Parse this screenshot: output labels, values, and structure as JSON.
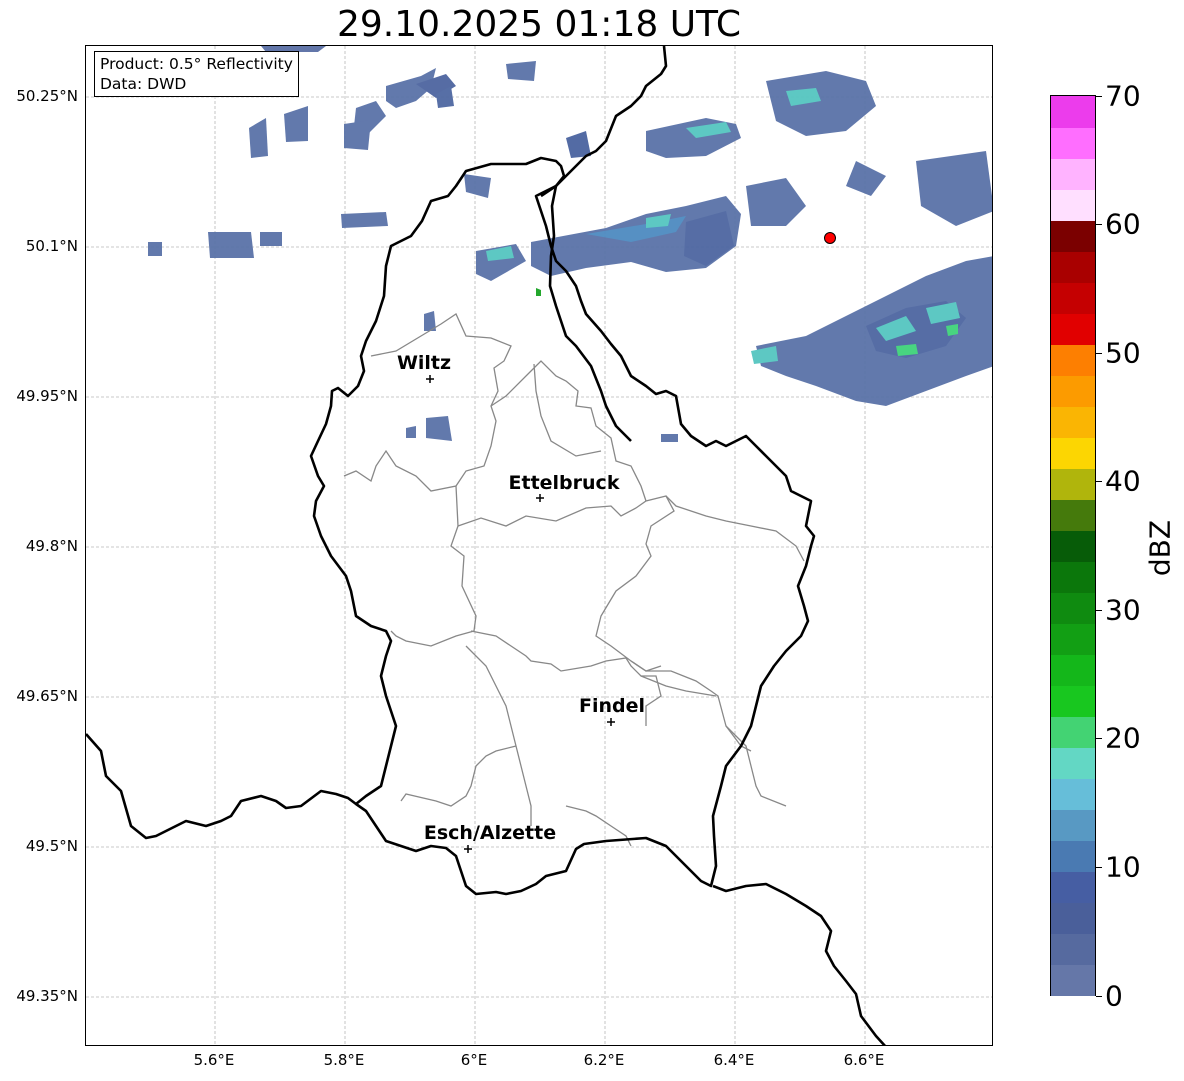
{
  "title": "29.10.2025 01:18 UTC",
  "info": {
    "product": "Product: 0.5° Reflectivity",
    "source": "Data: DWD"
  },
  "map": {
    "lat_labels": [
      "50.25°N",
      "50.1°N",
      "49.95°N",
      "49.8°N",
      "49.65°N",
      "49.5°N",
      "49.35°N"
    ],
    "lon_labels": [
      "5.6°E",
      "5.8°E",
      "6°E",
      "6.2°E",
      "6.4°E",
      "6.6°E"
    ],
    "cities": [
      {
        "name": "Wiltz",
        "lon": 5.93,
        "lat": 49.966
      },
      {
        "name": "Ettelbruck",
        "lon": 6.1,
        "lat": 49.85
      },
      {
        "name": "Findel",
        "lon": 6.21,
        "lat": 49.627
      },
      {
        "name": "Esch/Alzette",
        "lon": 5.99,
        "lat": 49.5
      }
    ],
    "radar_site": {
      "lon": 6.548,
      "lat": 50.11,
      "color": "#ff0000"
    }
  },
  "colorbar": {
    "label": "dBZ",
    "ticks": [
      "0",
      "10",
      "20",
      "30",
      "40",
      "50",
      "60",
      "70"
    ],
    "colors": [
      "#6577a8",
      "#566a9f",
      "#4a5f9a",
      "#465ea3",
      "#4a7ab2",
      "#5899c3",
      "#66bed9",
      "#63d7c4",
      "#43d373",
      "#18c71f",
      "#14b71a",
      "#129f14",
      "#0f8b10",
      "#0b770b",
      "#075c08",
      "#457a0c",
      "#b0b50c",
      "#fcd602",
      "#fab503",
      "#fc9b00",
      "#fd7f01",
      "#e10000",
      "#c50001",
      "#a90000",
      "#7b0000",
      "#ffdfff",
      "#ffb3ff",
      "#ff6eff",
      "#ec3cec"
    ]
  }
}
